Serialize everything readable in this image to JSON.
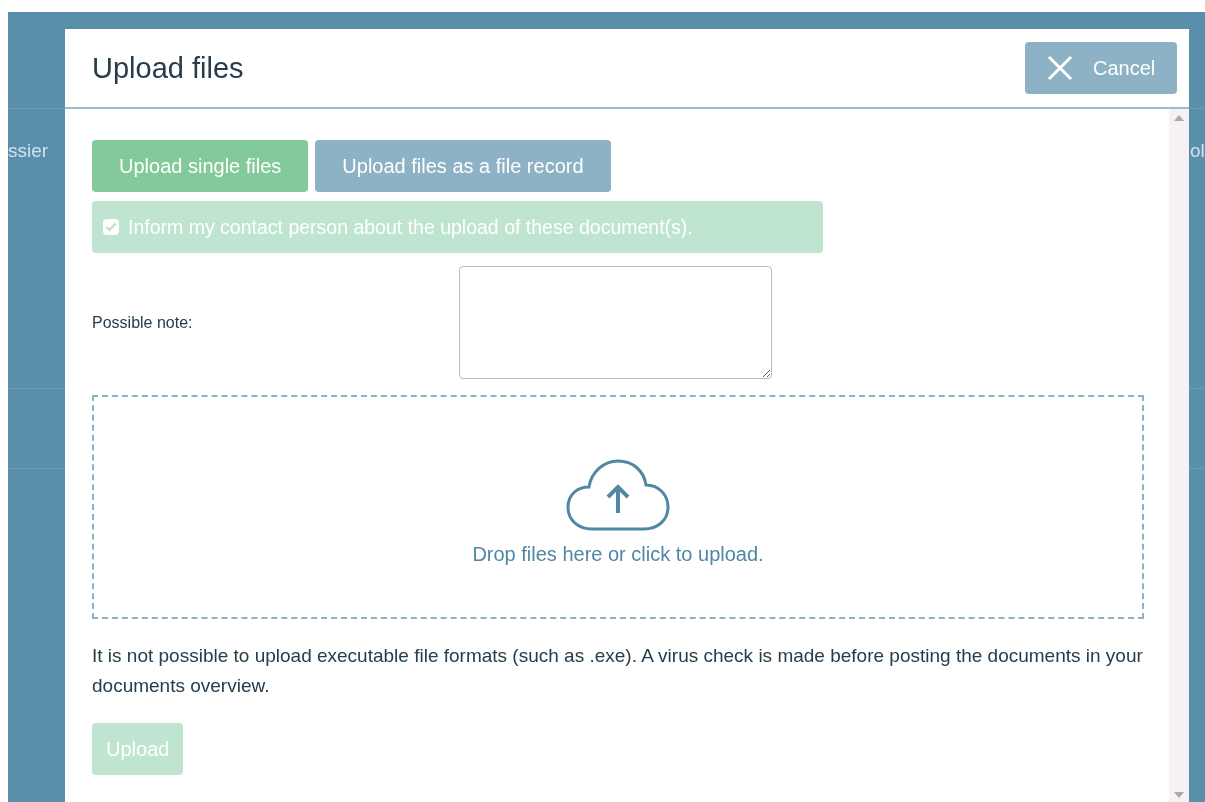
{
  "background_page": {
    "left_text": "ssier",
    "right_text": "ol"
  },
  "dialog": {
    "title": "Upload files",
    "cancel_button": "Cancel"
  },
  "tabs": [
    {
      "label": "Upload single files",
      "selected": true
    },
    {
      "label": "Upload files as a file record",
      "selected": false
    }
  ],
  "inform_option": {
    "label": "Inform my contact person about the upload of these document(s).",
    "checked": true
  },
  "note": {
    "label": "Possible note:"
  },
  "drop_zone": {
    "text": "Drop files here or click to upload."
  },
  "info_text": "It is not possible to upload executable file formats (such as .exe). A virus check is made before posting the documents in your documents overview.",
  "upload_button": {
    "label": "Upload",
    "disabled": true
  }
}
